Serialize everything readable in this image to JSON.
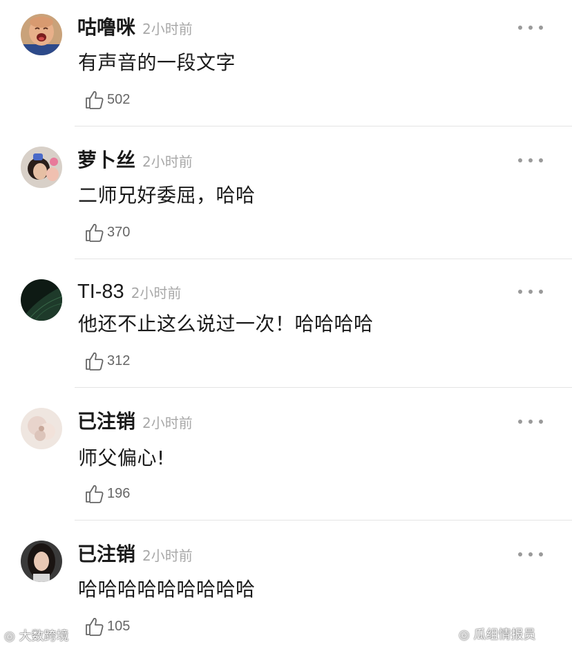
{
  "comments": [
    {
      "username": "咕噜咪",
      "time": "2小时前",
      "text": "有声音的一段文字",
      "likes": "502",
      "avatar": "crying-baby-avatar"
    },
    {
      "username": "萝卜丝",
      "time": "2小时前",
      "text": "二师兄好委屈，哈哈",
      "likes": "370",
      "avatar": "selfie-avatar"
    },
    {
      "username": "TI-83",
      "time": "2小时前",
      "text": "他还不止这么说过一次！哈哈哈哈",
      "likes": "312",
      "avatar": "dark-green-avatar"
    },
    {
      "username": "已注销",
      "time": "2小时前",
      "text": "师父偏心!",
      "likes": "196",
      "avatar": "pale-flower-avatar"
    },
    {
      "username": "已注销",
      "time": "2小时前",
      "text": "哈哈哈哈哈哈哈哈哈",
      "likes": "105",
      "avatar": "portrait-avatar"
    }
  ],
  "watermarks": {
    "left": "大数跨境",
    "right": "瓜组情报员"
  },
  "colors": {
    "text": "#1a1a1a",
    "timestamp": "#a8a8a8",
    "divider": "#e4e4e4",
    "icon": "#666666"
  }
}
